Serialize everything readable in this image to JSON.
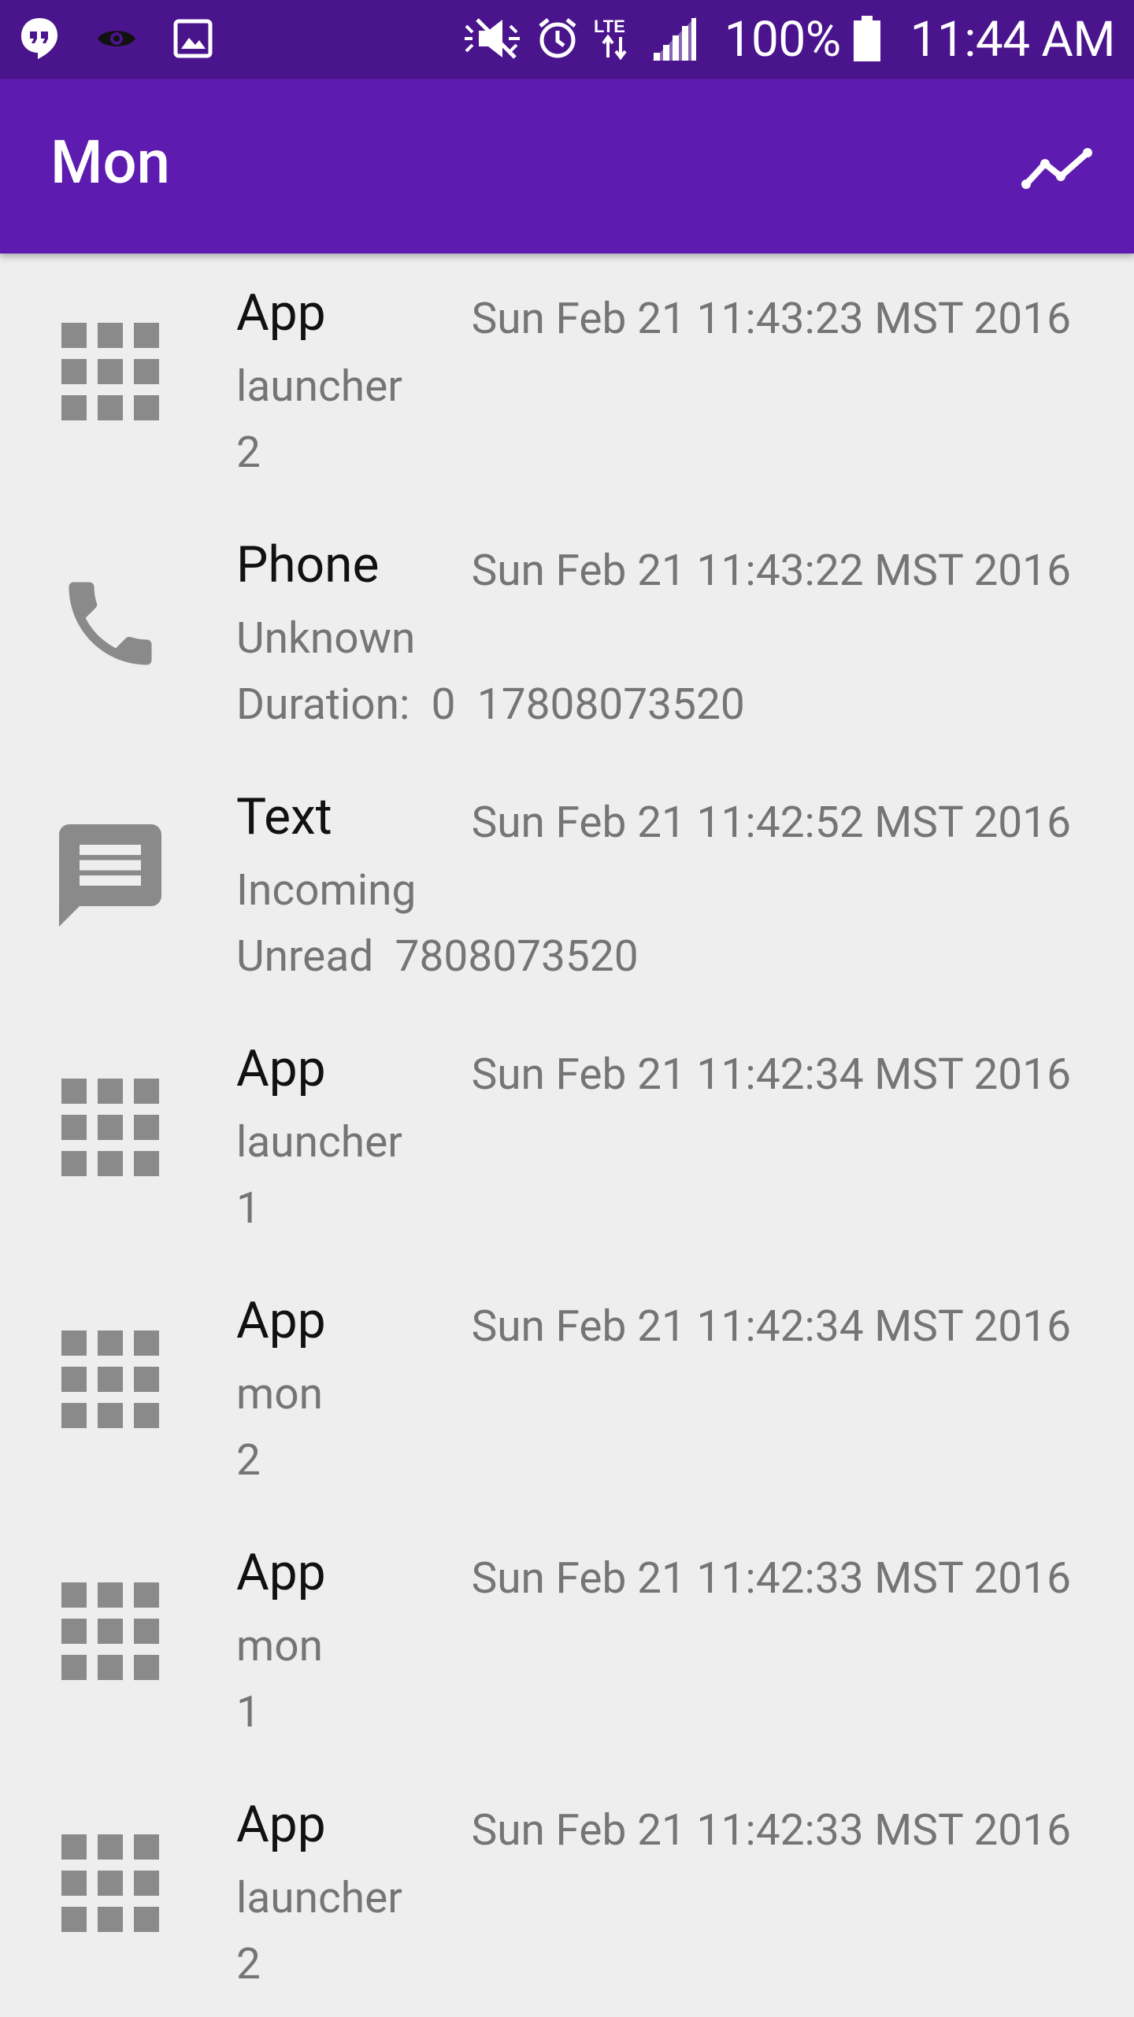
{
  "status_bar": {
    "left_icons": [
      "hangouts-icon",
      "eye-icon",
      "gallery-icon"
    ],
    "right_icons": [
      "mute-icon",
      "alarm-icon",
      "lte-icon",
      "signal-icon"
    ],
    "battery_percent": "100%",
    "time": "11:44 AM"
  },
  "app_bar": {
    "title": "Mon",
    "action_icon": "trending-up-icon"
  },
  "colors": {
    "status_bar": "#4a148c",
    "app_bar": "#5e1bb0",
    "background": "#eeeeee",
    "icon_grey": "#8a8a8a"
  },
  "items": [
    {
      "icon": "apps",
      "title": "App",
      "time": "Sun Feb 21 11:43:23 MST 2016",
      "line1": "launcher",
      "line2": "2"
    },
    {
      "icon": "phone",
      "title": "Phone",
      "time": "Sun Feb 21 11:43:22 MST 2016",
      "line1": "Unknown",
      "line2": "Duration:  0  17808073520"
    },
    {
      "icon": "message",
      "title": "Text",
      "time": "Sun Feb 21 11:42:52 MST 2016",
      "line1": "Incoming",
      "line2": "Unread  7808073520"
    },
    {
      "icon": "apps",
      "title": "App",
      "time": "Sun Feb 21 11:42:34 MST 2016",
      "line1": "launcher",
      "line2": "1"
    },
    {
      "icon": "apps",
      "title": "App",
      "time": "Sun Feb 21 11:42:34 MST 2016",
      "line1": "mon",
      "line2": "2"
    },
    {
      "icon": "apps",
      "title": "App",
      "time": "Sun Feb 21 11:42:33 MST 2016",
      "line1": "mon",
      "line2": "1"
    },
    {
      "icon": "apps",
      "title": "App",
      "time": "Sun Feb 21 11:42:33 MST 2016",
      "line1": "launcher",
      "line2": "2"
    }
  ]
}
